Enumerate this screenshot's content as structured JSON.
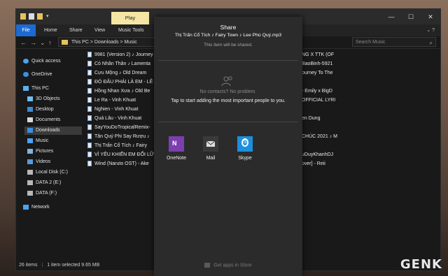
{
  "ribbon": {
    "tabs": [
      "File",
      "Home",
      "Share",
      "View",
      "Music Tools"
    ],
    "play": "Play"
  },
  "address": {
    "path": "This PC  >  Downloads  >  Music",
    "search_placeholder": "Search Music"
  },
  "sidebar": {
    "items": [
      "Quick access",
      "OneDrive",
      "This PC",
      "3D Objects",
      "Desktop",
      "Documents",
      "Downloads",
      "Music",
      "Pictures",
      "Videos",
      "Local Disk (C:)",
      "DATA 2 (E:)",
      "DATA (F:)",
      "Network"
    ]
  },
  "files": [
    "9981 (Version 2) ♪ Journey",
    "Cỏ Nhãn Thân ♪ Lamenta",
    "Cựu Mộng ♪ Old Dream",
    "ĐÓ ĐÂU PHẢI LÀ EM - LÊ",
    "Hồng Nhan Xưa ♪ Old Be",
    "Le  Ra - Vinh Khuat",
    "Nghien - Vinh Khuat",
    "Quá Lâu - Vinh Khuat",
    "SayYouDoTropicalRemix-",
    "Tân Quý Phi Say Rượu ♪",
    "Thị Trấn Cổ Tích ♪ Fairy",
    "VÌ YÊU KHIẾN EM ĐỔI LỮ",
    "Wind (Naruto OST) - Ake"
  ],
  "files_right": [
    "NG X TTK (OF",
    "BaoBinh-5921",
    "ourney To The",
    "",
    "- Emily x BigD",
    "OFFICIAL LYRI",
    "",
    "en Dung",
    "",
    "CHÚC 2021 ♪ M",
    "",
    "uDuyKhanhDJ",
    "over] - Reii"
  ],
  "status": {
    "items": "26 items",
    "selected": "1 item selected  9.65 MB"
  },
  "share": {
    "title": "Share",
    "file_name": "Thị Trấn Cổ Tích ♪ Fairy Town ♪ Lee Phú Quý.mp3",
    "note": "This item will be shared.",
    "no_contacts": "No contacts? No problem.",
    "tap_text": "Tap to start adding the most important people to you.",
    "apps": [
      {
        "label": "OneNote",
        "color": "#7b3fb0"
      },
      {
        "label": "Mail",
        "color": "#3a3a3a"
      },
      {
        "label": "Skype",
        "color": "#1b8fe0"
      }
    ],
    "store_label": "Get apps in Store"
  },
  "watermark": "GENK"
}
